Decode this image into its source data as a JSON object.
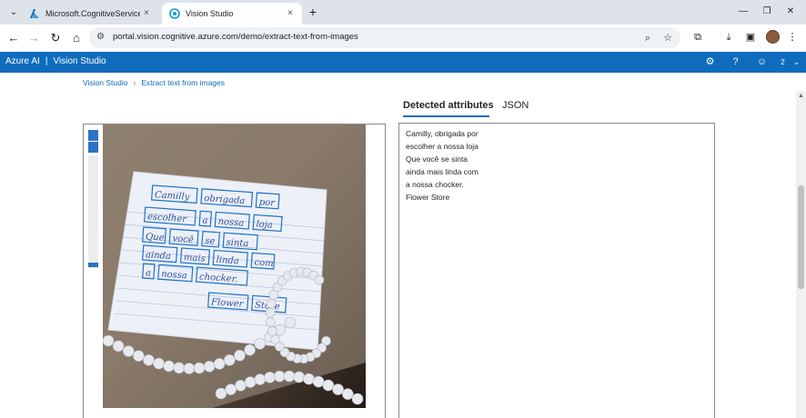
{
  "browser": {
    "tabs": [
      {
        "title": "Microsoft.CognitiveServicesAllI",
        "active": false,
        "icon": "azure-logo-icon"
      },
      {
        "title": "Vision Studio",
        "active": true,
        "icon": "vision-studio-icon"
      }
    ],
    "tab_close_glyph": "×",
    "new_tab_glyph": "+",
    "url": "portal.vision.cognitive.azure.com/demo/extract-text-from-images"
  },
  "app": {
    "brand": "Azure AI",
    "separator": "|",
    "product": "Vision Studio",
    "help_glyph": "?",
    "notification_count": "2"
  },
  "breadcrumb": {
    "home": "Vision Studio",
    "current": "Extract text from images"
  },
  "result_tabs": {
    "active": "Detected attributes",
    "inactive": "JSON"
  },
  "detected_text": [
    "Camilly, obrigada por",
    "escolher a nossa loja",
    "Que você se sinta",
    "ainda mais linda com",
    "a nossa chocker.",
    "Flower Store"
  ],
  "image": {
    "handwritten_lines": [
      [
        "Camilly",
        "obrigada",
        "por"
      ],
      [
        "escolher",
        "a",
        "nossa",
        "loja"
      ],
      [
        "Que",
        "você",
        "se",
        "sinta"
      ],
      [
        "ainda",
        "mais",
        "linda",
        "com"
      ],
      [
        "a",
        "nossa",
        "chocker."
      ],
      [
        "Flower",
        "Store"
      ]
    ]
  },
  "colors": {
    "accent": "#0f6cbd",
    "bounding_box": "#1a73c9",
    "tabstrip": "#dee3ea"
  }
}
